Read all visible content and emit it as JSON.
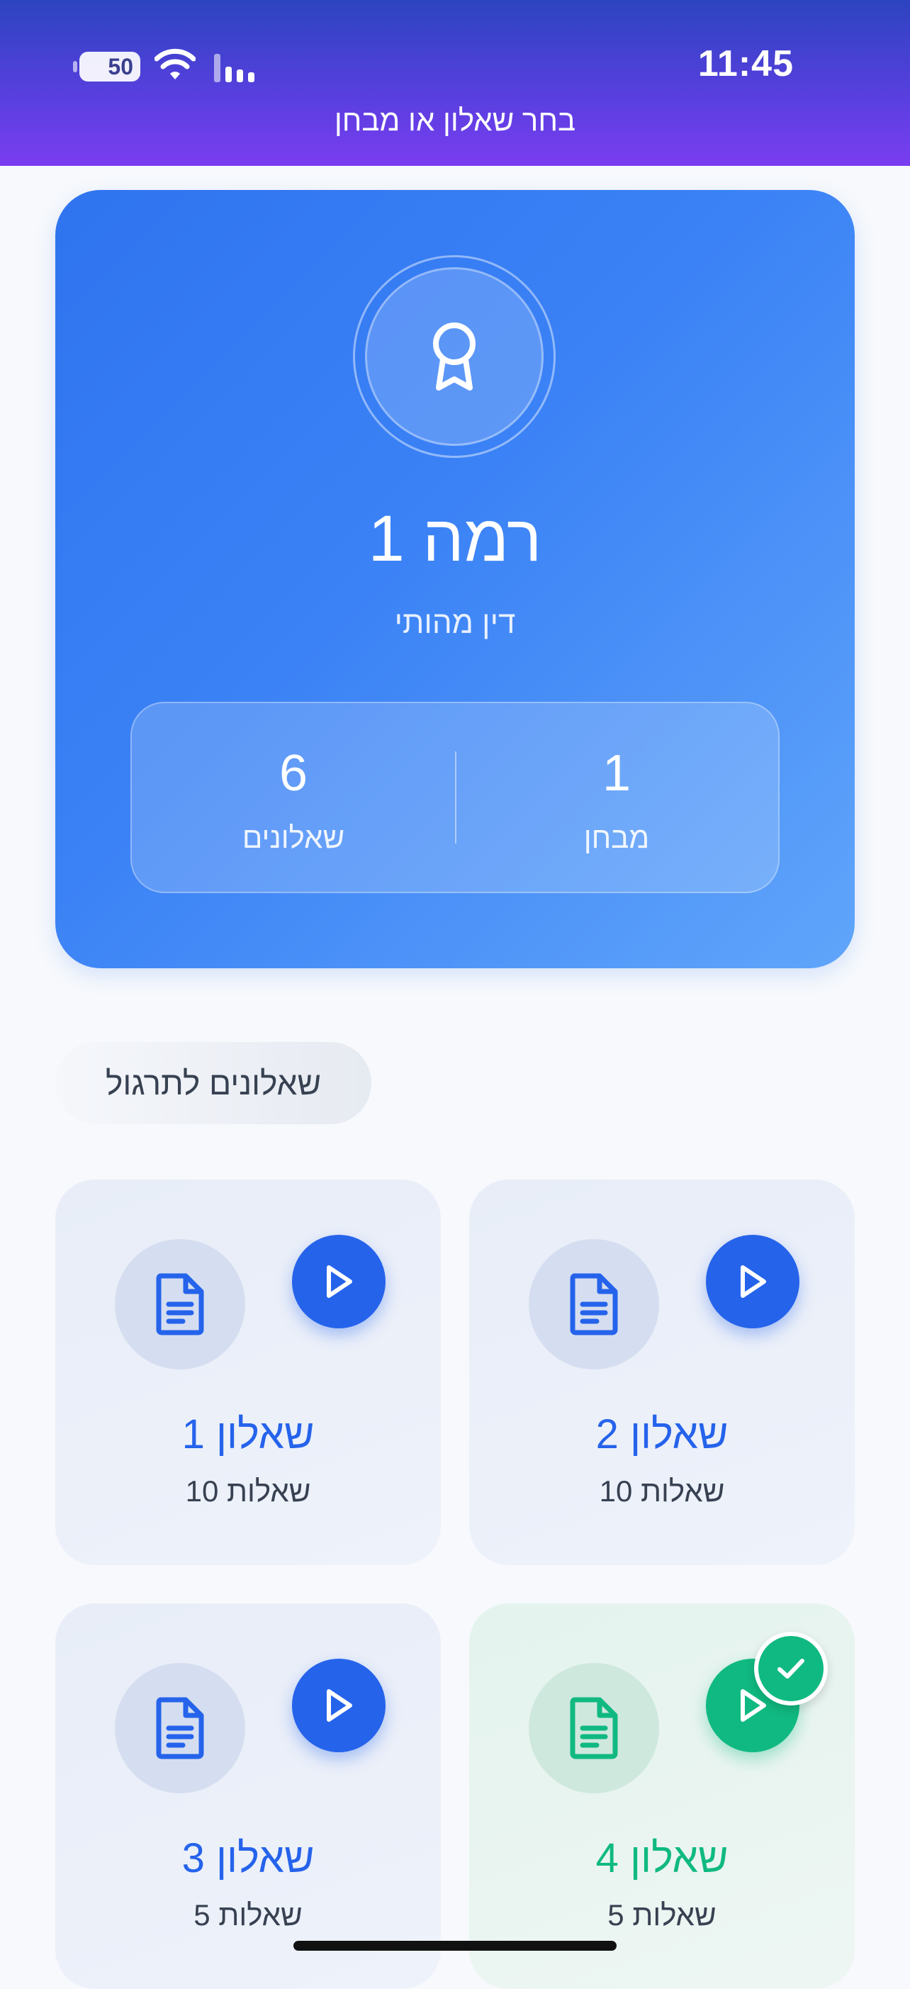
{
  "status_bar": {
    "battery": "50",
    "time": "11:45",
    "icons": [
      "battery-icon",
      "wifi-icon",
      "cellular-signal-icon"
    ]
  },
  "header": {
    "title": "בחר שאלון או מבחן"
  },
  "level_card": {
    "icon": "award-medal-icon",
    "title": "רמה 1",
    "subtitle": "דין מהותי",
    "stats": [
      {
        "value": "6",
        "label": "שאלונים"
      },
      {
        "value": "1",
        "label": "מבחן"
      }
    ]
  },
  "section": {
    "title": "שאלונים לתרגול"
  },
  "questionnaires": [
    {
      "title": "שאלון 1",
      "count": "10 שאלות",
      "completed": false
    },
    {
      "title": "שאלון 2",
      "count": "10 שאלות",
      "completed": false
    },
    {
      "title": "שאלון 3",
      "count": "5 שאלות",
      "completed": false
    },
    {
      "title": "שאלון 4",
      "count": "5 שאלות",
      "completed": true
    }
  ],
  "colors": {
    "primary": "#2563eb",
    "success": "#10b981",
    "header_start": "#2c44c0",
    "header_end": "#7a3df0",
    "card_blue": "#3b82f6"
  }
}
